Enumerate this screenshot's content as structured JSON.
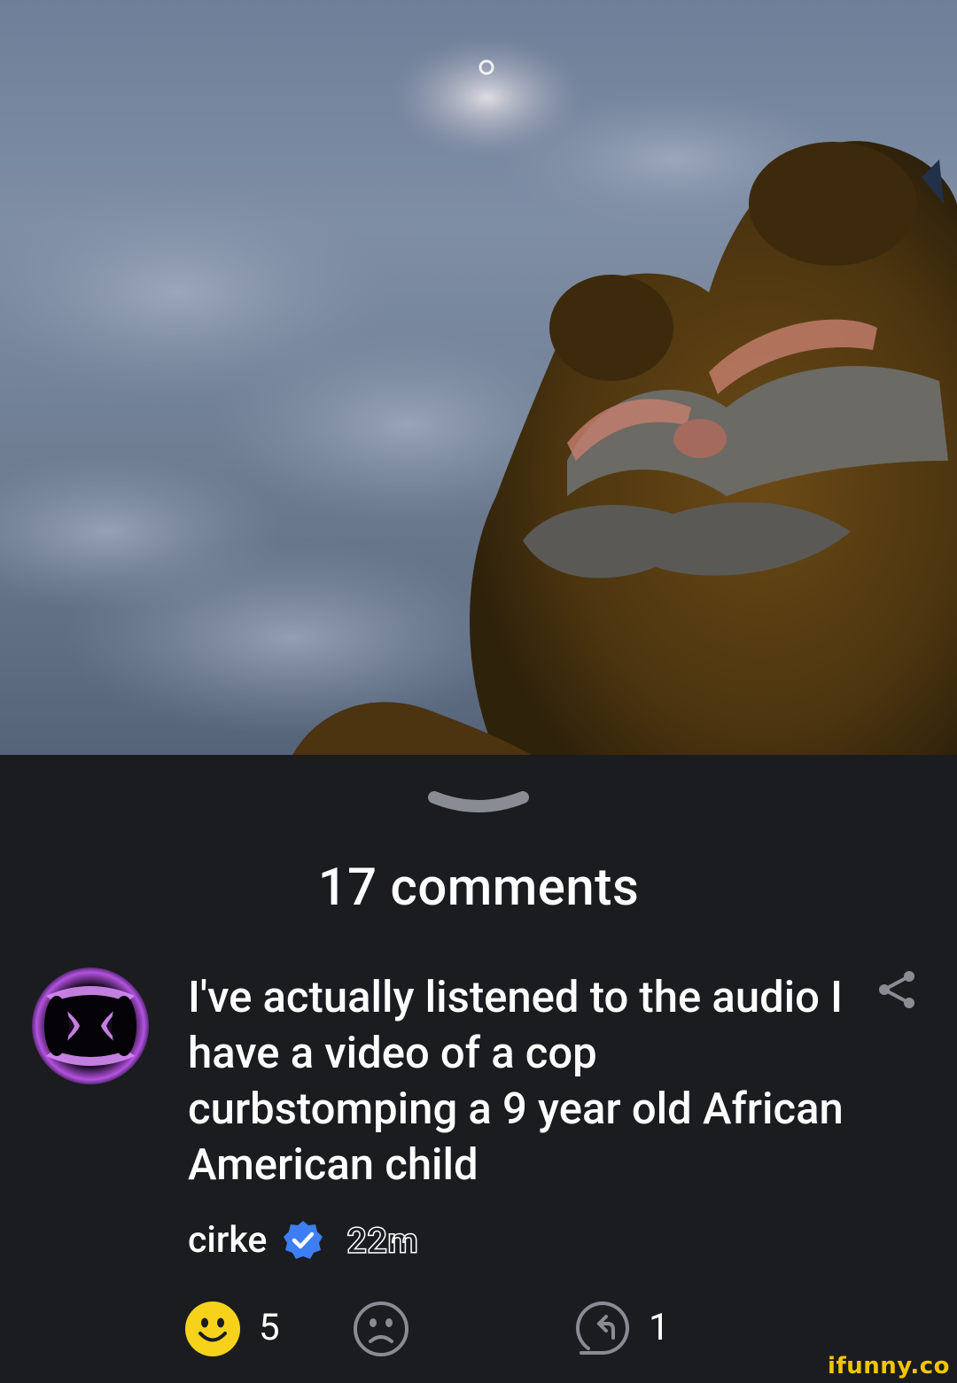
{
  "comments_header": {
    "count_label": "17 comments"
  },
  "comment": {
    "text": "I've actually listened to the audio I have a video of a cop curbstomping a 9 year old African American child",
    "username": "cirke",
    "time": "22m",
    "smile_count": "5",
    "reply_count": "1"
  },
  "watermark": "ifunny.co",
  "colors": {
    "background": "#1b1c20",
    "smile_yellow": "#f6d21b",
    "verified_blue": "#3d7ef5",
    "avatar_purple": "#b452e0",
    "icon_gray": "#8a8c93",
    "watermark_yellow": "#f3c500"
  }
}
